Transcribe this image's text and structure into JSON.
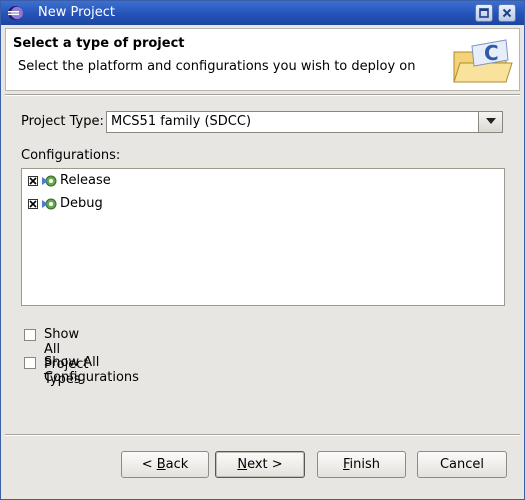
{
  "window": {
    "title": "New Project",
    "maximize_icon": "maximize-icon",
    "close_icon": "close-icon"
  },
  "header": {
    "heading": "Select a type of project",
    "description": "Select the platform and configurations you wish to deploy on",
    "icon": "c-project-folder-icon"
  },
  "project_type": {
    "label": "Project Type:",
    "selected": "MCS51 family (SDCC)"
  },
  "configurations": {
    "label": "Configurations:",
    "items": [
      {
        "label": "Release",
        "checked": true
      },
      {
        "label": "Debug",
        "checked": true
      }
    ]
  },
  "options": {
    "show_all_project_types": {
      "label": "Show All Project Types",
      "checked": false
    },
    "show_all_configurations": {
      "label": "Show All Configurations",
      "checked": false
    }
  },
  "buttons": {
    "back": {
      "mnemonic": "B",
      "prefix": "< ",
      "rest": "ack"
    },
    "next": {
      "mnemonic": "N",
      "rest": "ext >"
    },
    "finish": {
      "mnemonic": "F",
      "rest": "inish"
    },
    "cancel": {
      "label": "Cancel"
    }
  },
  "colors": {
    "titlebar": "#2553b8",
    "face": "#e8e6e2"
  }
}
